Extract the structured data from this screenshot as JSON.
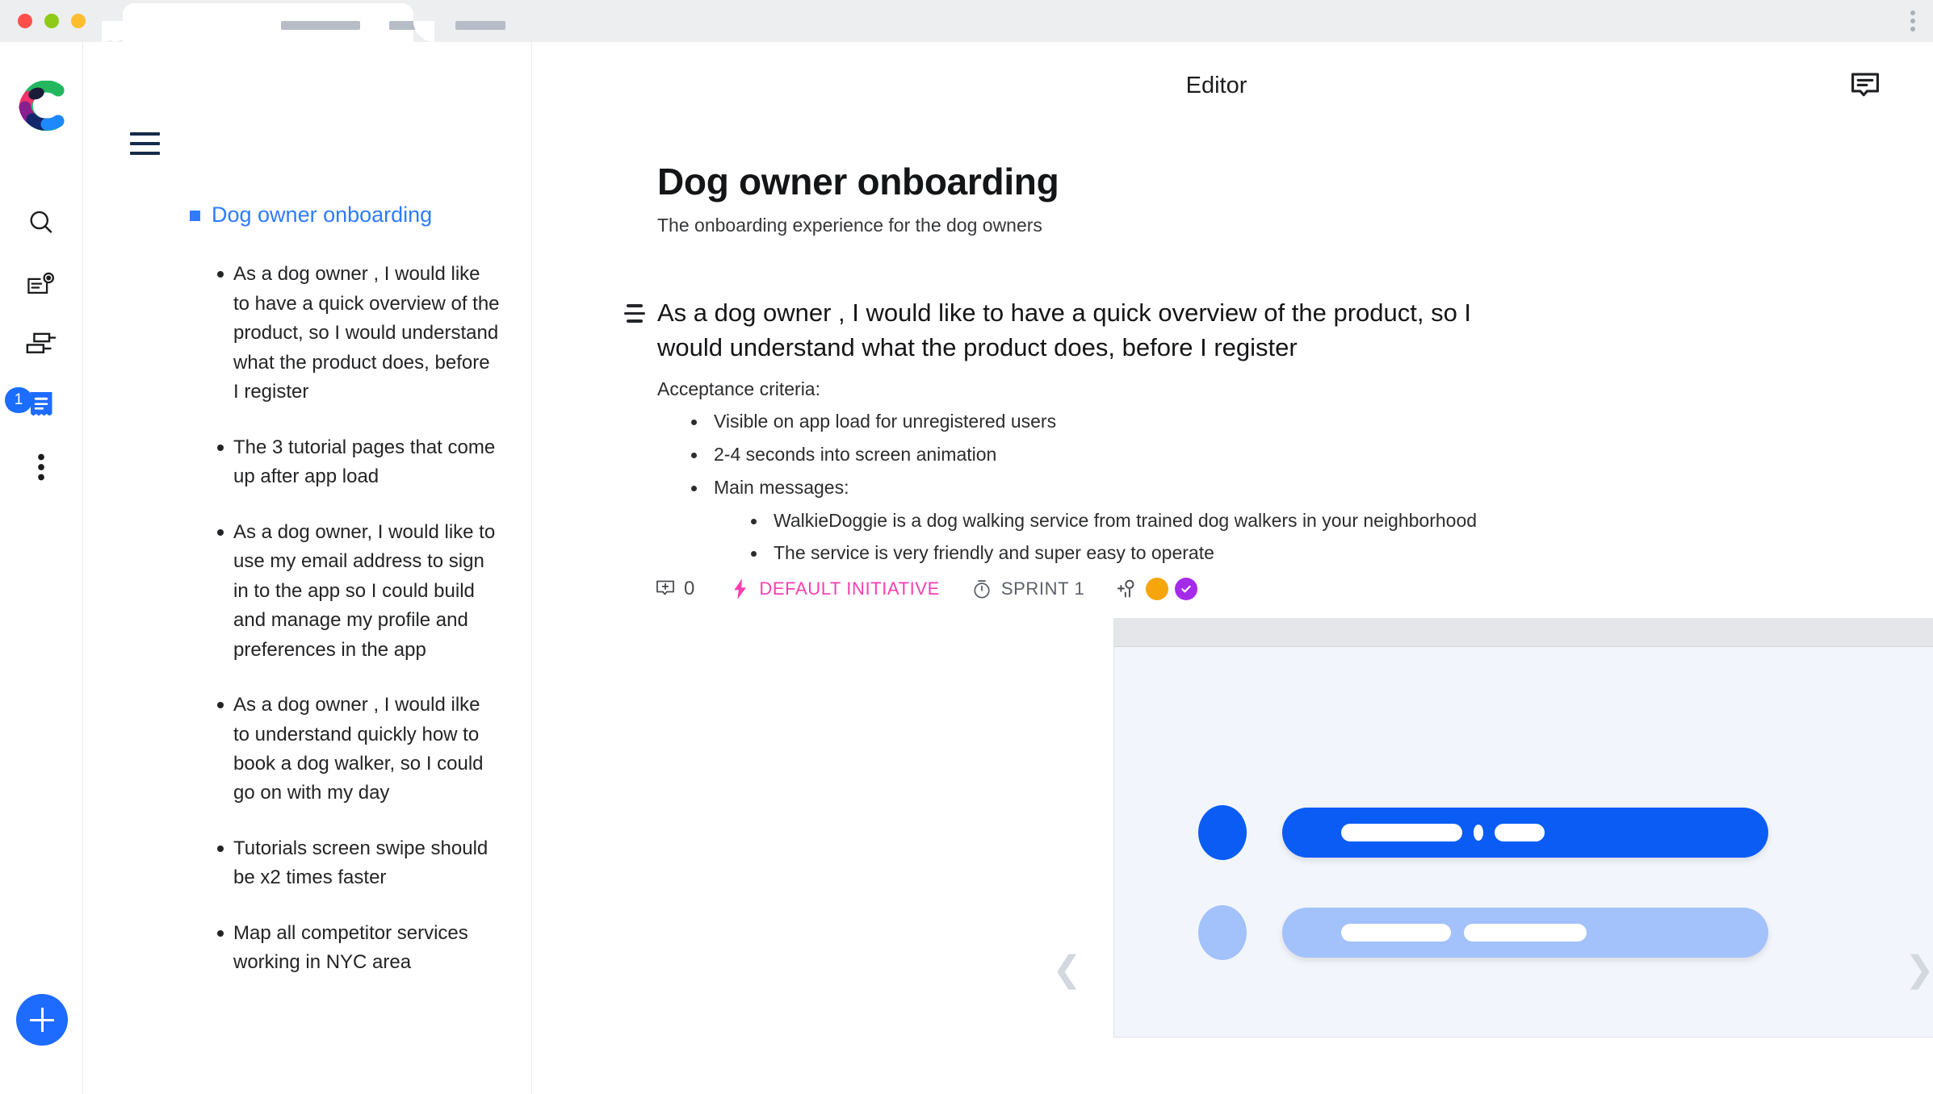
{
  "browser": {
    "traffic_lights": [
      "close",
      "minimize",
      "zoom"
    ],
    "tab_placeholders": 3,
    "menu_icon": "kebab-menu-icon"
  },
  "sidebar": {
    "logo": "craft-logo",
    "items": [
      {
        "name": "search",
        "icon": "search-icon",
        "badge": null
      },
      {
        "name": "roadmap",
        "icon": "map-pin-document-icon",
        "badge": null
      },
      {
        "name": "timeline",
        "icon": "gantt-chart-icon",
        "badge": "1"
      },
      {
        "name": "documents",
        "icon": "document-active-icon",
        "badge": null
      },
      {
        "name": "more",
        "icon": "more-vertical-icon",
        "badge": null
      }
    ],
    "add_button_label": "+",
    "accent_color": "#1e6bff",
    "badge_color": "#1a6dff"
  },
  "outline": {
    "menu_icon": "hamburger-menu-icon",
    "title": "Dog owner onboarding",
    "title_color": "#2e7bff",
    "items": [
      "As a dog owner , I would like to have a quick overview of the product, so I would understand what the product does, before I register",
      "The 3 tutorial pages that come up after app load",
      "As a dog owner, I would like to use my email address to sign in to the app so I could build and manage my profile and preferences in the app",
      "As a dog owner , I would ilke to understand quickly how to book a dog walker, so I could go on with my day",
      "Tutorials screen swipe should be x2 times faster",
      "Map all competitor services working in NYC area"
    ]
  },
  "header": {
    "title": "Editor",
    "comment_icon": "comment-bubble-icon"
  },
  "document": {
    "title": "Dog owner onboarding",
    "subtitle": "The onboarding experience for the dog owners"
  },
  "story": {
    "handle_icon": "align-lines-icon",
    "title": "As a dog owner , I would like to have a quick overview of the product, so I would understand what the product does, before I register",
    "acceptance_label": "Acceptance criteria:",
    "criteria": [
      "Visible on app load for unregistered users",
      "2-4 seconds into screen animation",
      "Main messages:"
    ],
    "sub_criteria": [
      "WalkieDoggie is a dog walking service from trained dog walkers in your neighborhood",
      "The service is very friendly and super easy to operate"
    ],
    "meta": {
      "comment_icon": "add-comment-icon",
      "comment_count": "0",
      "initiative_icon": "lightning-bolt-icon",
      "initiative_label": "DEFAULT INITIATIVE",
      "initiative_color": "#f93eb0",
      "sprint_icon": "timer-icon",
      "sprint_label": "SPRINT 1",
      "sprint_color": "#5c6069",
      "add_person_icon": "add-person-icon",
      "avatars": [
        {
          "name": "avatar-orange",
          "color": "#f7a50c"
        },
        {
          "name": "avatar-purple-verified",
          "color": "#a42bea"
        }
      ]
    }
  },
  "attachment": {
    "prev_icon": "chevron-left-icon",
    "next_icon": "chevron-right-icon",
    "tools": [
      {
        "name": "crop-icon"
      },
      {
        "name": "expand-icon"
      },
      {
        "name": "preview-eye-icon"
      }
    ],
    "mockup": {
      "background": "#f2f6fc",
      "header_color": "#e4e6e9",
      "rows": [
        {
          "circle_color": "#0a5cf5",
          "bar_color": "#0a5cf5"
        },
        {
          "circle_color": "#a3c1fb",
          "bar_color": "#a3c1fb"
        }
      ]
    }
  }
}
